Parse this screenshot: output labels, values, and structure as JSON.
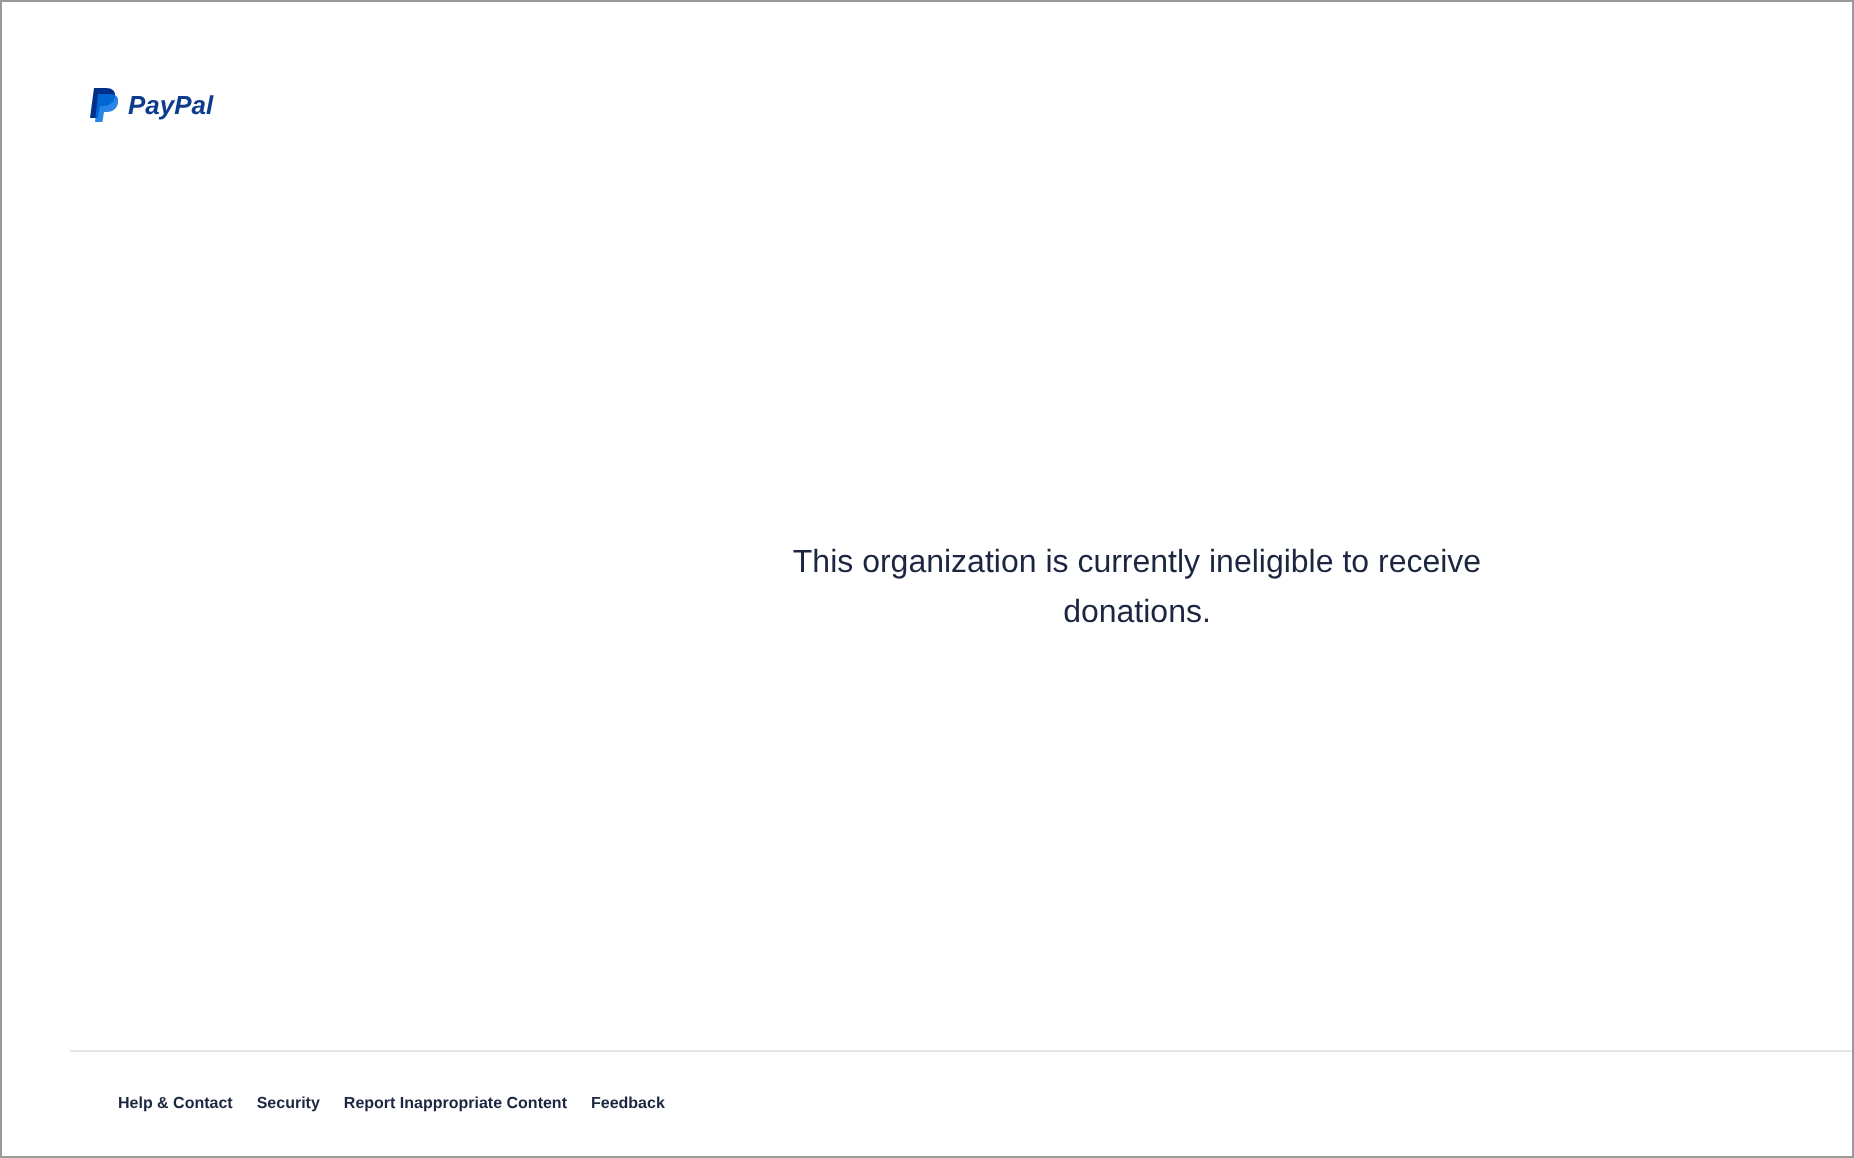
{
  "header": {
    "logo": "PayPal"
  },
  "message": "This organization is currently ineligible to receive donations.",
  "footer": {
    "links": [
      "Help & Contact",
      "Security",
      "Report Inappropriate Content",
      "Feedback"
    ]
  }
}
